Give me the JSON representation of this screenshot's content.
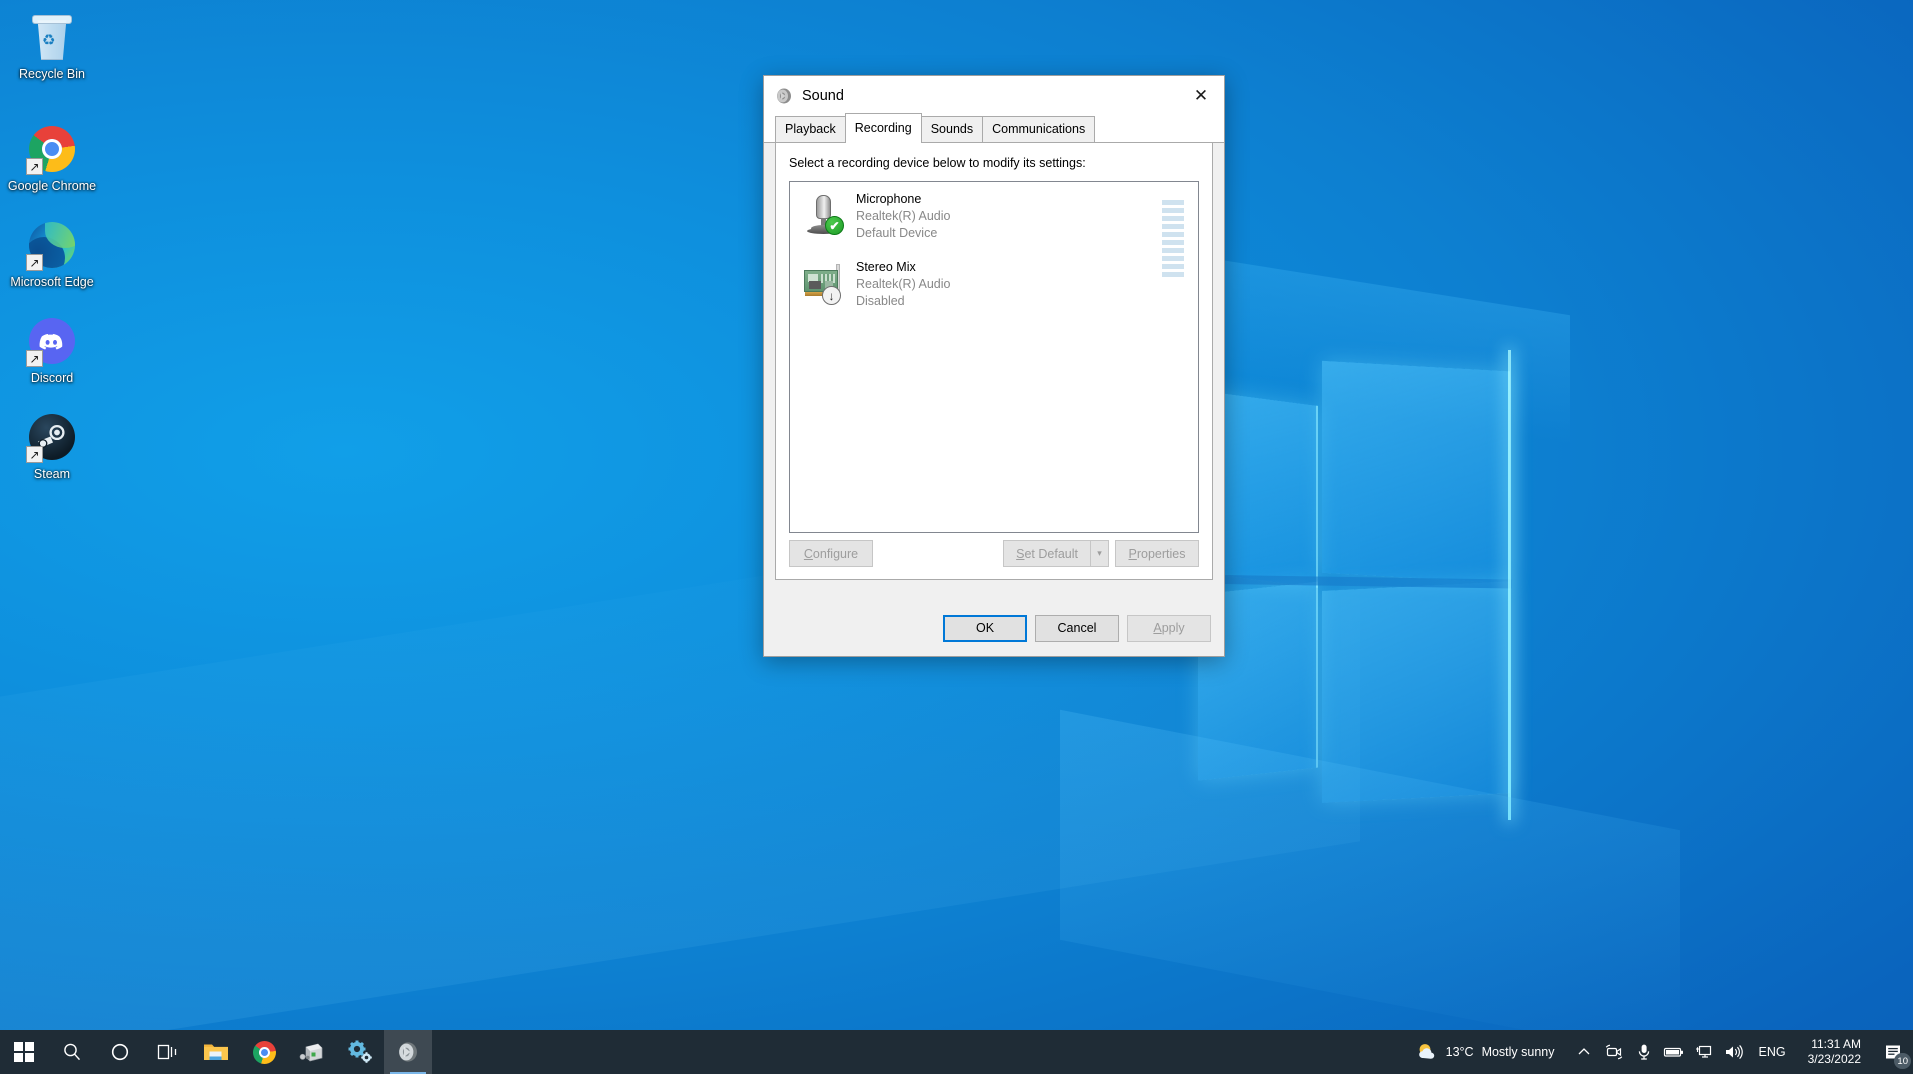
{
  "desktop": {
    "icons": [
      {
        "name": "Recycle Bin",
        "icon": "recycle-bin-icon",
        "shortcut": false
      },
      {
        "name": "Google Chrome",
        "icon": "chrome-icon",
        "shortcut": true
      },
      {
        "name": "Microsoft Edge",
        "icon": "edge-icon",
        "shortcut": true
      },
      {
        "name": "Discord",
        "icon": "discord-icon",
        "shortcut": true
      },
      {
        "name": "Steam",
        "icon": "steam-icon",
        "shortcut": true
      }
    ]
  },
  "dialog": {
    "title": "Sound",
    "title_icon": "speaker-icon",
    "close_label": "✕",
    "tabs": [
      {
        "label": "Playback",
        "active": false
      },
      {
        "label": "Recording",
        "active": true
      },
      {
        "label": "Sounds",
        "active": false
      },
      {
        "label": "Communications",
        "active": false
      }
    ],
    "instruction": "Select a recording device below to modify its settings:",
    "devices": [
      {
        "name": "Microphone",
        "driver": "Realtek(R) Audio",
        "status": "Default Device",
        "icon": "microphone-icon",
        "badge": "default-check-badge",
        "badge_glyph": "✔",
        "has_meter": true
      },
      {
        "name": "Stereo Mix",
        "driver": "Realtek(R) Audio",
        "status": "Disabled",
        "icon": "sound-card-icon",
        "badge": "disabled-arrow-badge",
        "badge_glyph": "↓",
        "has_meter": false
      }
    ],
    "meter": {
      "segments": 10,
      "active_segments": 0,
      "color": "#cfe2ef"
    },
    "actions": {
      "configure": {
        "label": "Configure",
        "accel": "C",
        "disabled": true
      },
      "set_default": {
        "label": "Set Default",
        "accel": "S",
        "disabled": true
      },
      "set_default_arrow": {
        "label": "▾",
        "disabled": true
      },
      "properties": {
        "label": "Properties",
        "accel": "P",
        "disabled": true
      }
    },
    "footer": {
      "ok": {
        "label": "OK",
        "focused": true,
        "disabled": false
      },
      "cancel": {
        "label": "Cancel",
        "focused": false,
        "disabled": false
      },
      "apply": {
        "label": "Apply",
        "accel": "A",
        "focused": false,
        "disabled": true
      }
    }
  },
  "taskbar": {
    "buttons": [
      {
        "name": "start-button",
        "icon": "windows-logo-icon"
      },
      {
        "name": "search-button",
        "icon": "search-icon"
      },
      {
        "name": "cortana-button",
        "icon": "cortana-circle-icon"
      },
      {
        "name": "task-view-button",
        "icon": "task-view-icon"
      },
      {
        "name": "file-explorer-button",
        "icon": "folder-icon"
      },
      {
        "name": "chrome-button",
        "icon": "chrome-icon"
      },
      {
        "name": "device-manager-button",
        "icon": "device-icon"
      },
      {
        "name": "settings-button",
        "icon": "gears-icon"
      },
      {
        "name": "sound-window-button",
        "icon": "speaker-icon",
        "active": true
      }
    ],
    "weather": {
      "temperature": "13°C",
      "condition": "Mostly sunny",
      "icon": "partly-cloudy-icon"
    },
    "tray": [
      {
        "name": "show-hidden-icons",
        "icon": "chevron-up-icon",
        "glyph": "∧"
      },
      {
        "name": "camera-icon",
        "glyph": "camera"
      },
      {
        "name": "microphone-icon",
        "glyph": "microphone"
      },
      {
        "name": "battery-icon",
        "glyph": "battery"
      },
      {
        "name": "network-icon",
        "glyph": "monitor"
      },
      {
        "name": "volume-icon",
        "glyph": "speaker"
      }
    ],
    "language": "ENG",
    "clock": {
      "time": "11:31 AM",
      "date": "3/23/2022"
    },
    "notifications": {
      "icon": "notification-icon",
      "count": "10"
    }
  }
}
